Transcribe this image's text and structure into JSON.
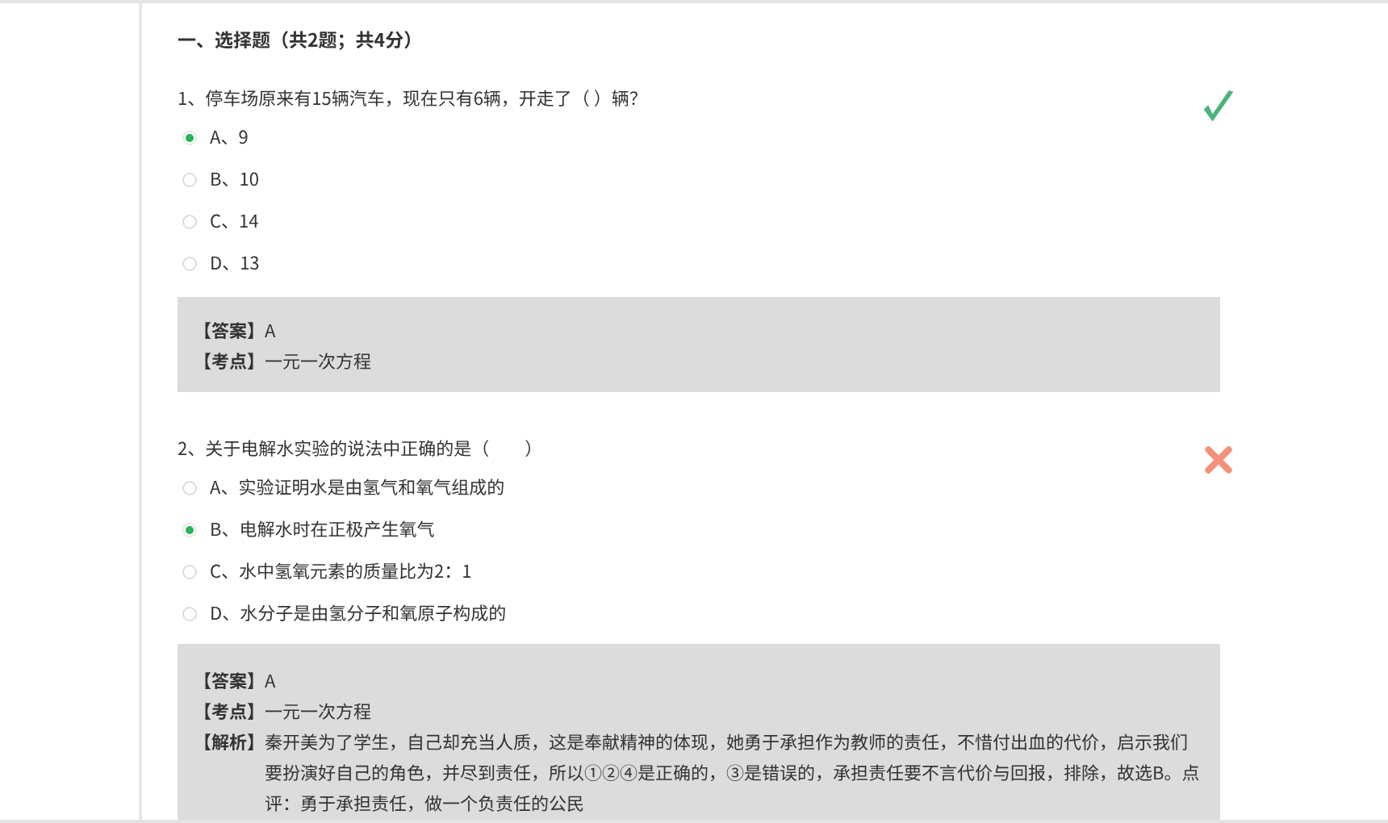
{
  "section_title": "一、选择题（共2题；共4分）",
  "questions": [
    {
      "stem": "1、停车场原来有15辆汽车，现在只有6辆，开走了（ ）辆？",
      "correct": true,
      "options": [
        {
          "label": "A、9",
          "selected": true
        },
        {
          "label": "B、10",
          "selected": false
        },
        {
          "label": "C、14",
          "selected": false
        },
        {
          "label": "D、13",
          "selected": false
        }
      ],
      "analysis": [
        {
          "label": "【答案】",
          "text": "A"
        },
        {
          "label": "【考点】",
          "text": "一元一次方程"
        }
      ]
    },
    {
      "stem": "2、关于电解水实验的说法中正确的是（　　）",
      "correct": false,
      "options": [
        {
          "label": "A、实验证明水是由氢气和氧气组成的",
          "selected": false
        },
        {
          "label": "B、电解水时在正极产生氧气",
          "selected": true
        },
        {
          "label": "C、水中氢氧元素的质量比为2：1",
          "selected": false
        },
        {
          "label": "D、水分子是由氢分子和氧原子构成的",
          "selected": false
        }
      ],
      "analysis": [
        {
          "label": "【答案】",
          "text": "A"
        },
        {
          "label": "【考点】",
          "text": "一元一次方程"
        },
        {
          "label": "【解析】",
          "text": "秦开美为了学生，自己却充当人质，这是奉献精神的体现，她勇于承担作为教师的责任，不惜付出血的代价，启示我们要扮演好自己的角色，并尽到责任，所以①②④是正确的，③是错误的，承担责任要不言代价与回报，排除，故选B。点评：勇于承担责任，做一个负责任的公民"
        }
      ]
    }
  ]
}
